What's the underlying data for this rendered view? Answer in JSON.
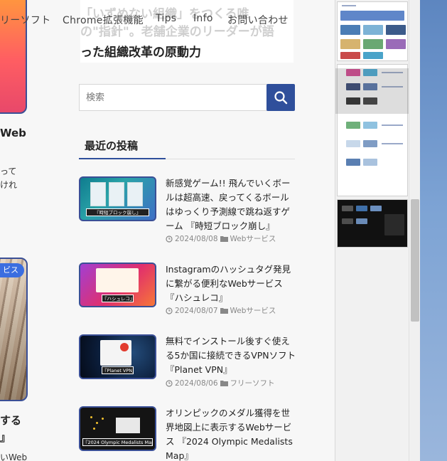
{
  "nav": {
    "items": [
      "リーソフト",
      "Chrome拡張機能",
      "Tips",
      "Info",
      "お問い合わせ"
    ]
  },
  "left_column": {
    "fragment_web": "Web",
    "fragment_text1": "って",
    "fragment_text2": "けれ",
    "badge": "ビス",
    "fragment_title1": "する",
    "fragment_title2": "』",
    "fragment_text3": "いWeb"
  },
  "article_header": {
    "faded_line1": "「いずめない組織」をつくる唯",
    "faded_line2": "の\"指針\"。老舗企業のリーダーが語",
    "title_line": "った組織改革の原動力"
  },
  "search": {
    "placeholder": "検索",
    "icon": "search-icon"
  },
  "recent_posts": {
    "heading": "最近の投稿",
    "items": [
      {
        "title": "新感覚ゲーム!! 飛んでいくボールは超高速、戻ってくるボールはゆっくり予測線で跳ね返すゲーム 『時短ブロック崩し』",
        "date": "2024/08/08",
        "category": "Webサービス",
        "thumb_caption": "『時短ブロック崩し』"
      },
      {
        "title": "Instagramのハッシュタグ発見に繋がる便利なWebサービス 『ハシュレコ』",
        "date": "2024/08/07",
        "category": "Webサービス",
        "thumb_caption": "『ハシュレコ』"
      },
      {
        "title": "無料でインストール後すぐ使える5か国に接続できるVPNソフト 『Planet VPN』",
        "date": "2024/08/06",
        "category": "フリーソフト",
        "thumb_caption": "『Planet VPN』"
      },
      {
        "title": "オリンピックのメダル獲得を世界地図上に表示するWebサービス 『2024 Olympic Medalists Map』",
        "date": "",
        "category": "",
        "thumb_caption": "『2024 Olympic Medalists Map』"
      }
    ]
  },
  "colors": {
    "accent": "#2f4f9b",
    "thumb_border": "#3a4f96",
    "background": "#f7f7f7"
  }
}
